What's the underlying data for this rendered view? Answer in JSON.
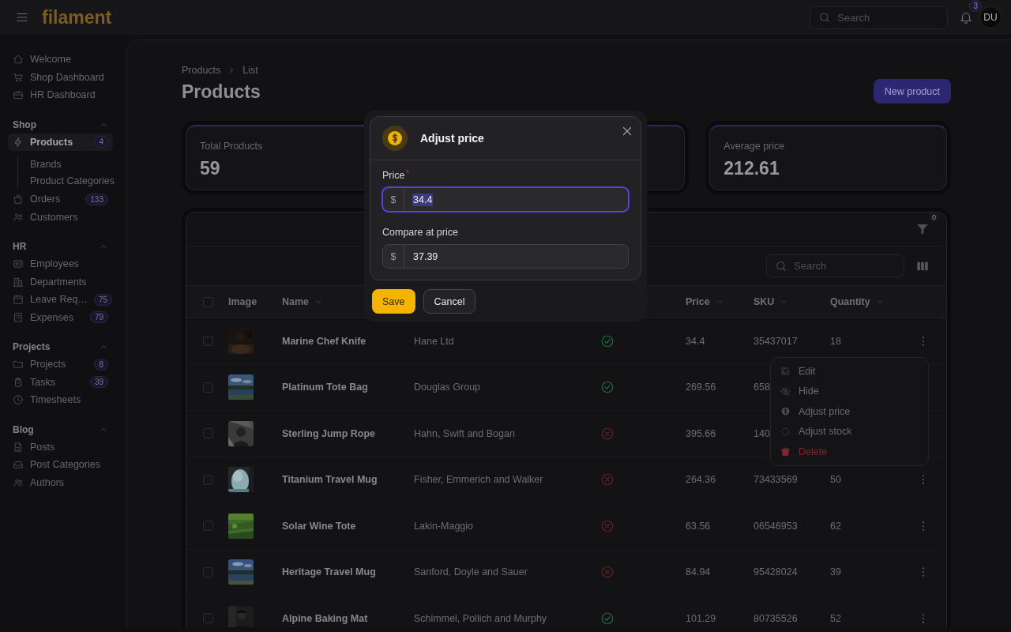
{
  "topbar": {
    "logo": "filament",
    "search": {
      "placeholder": "Search"
    },
    "notifications": {
      "count": "3"
    },
    "avatar": {
      "initials": "DU"
    }
  },
  "sidebar": {
    "groups": [
      {
        "items": [
          {
            "label": "Welcome",
            "selected": false
          },
          {
            "label": "Shop Dashboard",
            "selected": false
          },
          {
            "label": "HR Dashboard",
            "selected": false
          }
        ]
      },
      {
        "label": "Shop",
        "expanded": true,
        "items": [
          {
            "label": "Products",
            "badge": "4",
            "selected": true,
            "children": [
              {
                "label": "Brands",
                "selected": false
              },
              {
                "label": "Product Categories",
                "selected": false
              }
            ]
          },
          {
            "label": "Orders",
            "badge": "133",
            "selected": false
          },
          {
            "label": "Customers",
            "selected": false
          }
        ]
      },
      {
        "label": "HR",
        "expanded": true,
        "items": [
          {
            "label": "Employees",
            "selected": false
          },
          {
            "label": "Departments",
            "selected": false
          },
          {
            "label": "Leave Req…",
            "badge": "75",
            "selected": false
          },
          {
            "label": "Expenses",
            "badge": "79",
            "selected": false
          }
        ]
      },
      {
        "label": "Projects",
        "expanded": true,
        "items": [
          {
            "label": "Projects",
            "badge": "8",
            "selected": false
          },
          {
            "label": "Tasks",
            "badge": "39",
            "selected": false
          },
          {
            "label": "Timesheets",
            "selected": false
          }
        ]
      },
      {
        "label": "Blog",
        "expanded": true,
        "items": [
          {
            "label": "Posts",
            "selected": false
          },
          {
            "label": "Post Categories",
            "selected": false
          },
          {
            "label": "Authors",
            "selected": false
          }
        ]
      }
    ]
  },
  "breadcrumbs": [
    "Products",
    "List"
  ],
  "page_title": "Products",
  "header_action": {
    "label": "New product"
  },
  "stats": [
    {
      "kind": "stat",
      "label": "Total Products",
      "value": "59"
    },
    {
      "kind": "covered"
    },
    {
      "kind": "stat",
      "label": "Average price",
      "value": "212.61"
    }
  ],
  "table": {
    "filter_count": "0",
    "all_selected": false,
    "search": {
      "placeholder": "Search"
    },
    "columns": [
      {
        "kind": "label",
        "label": "Image",
        "sortable": false
      },
      {
        "kind": "label",
        "label": "Name",
        "sortable": true
      },
      {
        "kind": "covered"
      },
      {
        "kind": "covered"
      },
      {
        "kind": "label",
        "label": "Price",
        "sortable": true
      },
      {
        "kind": "label",
        "label": "SKU",
        "sortable": true
      },
      {
        "kind": "label",
        "label": "Quantity",
        "sortable": true
      }
    ],
    "rows": [
      {
        "selected": false,
        "name": "Marine Chef Knife",
        "brand": "Hane Ltd",
        "visible": true,
        "price": "34.4",
        "sku": "35437017",
        "quantity": "18",
        "actions": true
      },
      {
        "selected": false,
        "name": "Platinum Tote Bag",
        "brand": "Douglas Group",
        "visible": true,
        "price": "269.56",
        "sku": "658",
        "actions": false
      },
      {
        "selected": false,
        "name": "Sterling Jump Rope",
        "brand": "Hahn, Swift and Bogan",
        "visible": false,
        "price": "395.66",
        "sku": "140",
        "actions": false
      },
      {
        "selected": false,
        "name": "Titanium Travel Mug",
        "brand": "Fisher, Emmerich and Walker",
        "visible": false,
        "price": "264.36",
        "sku": "73433569",
        "quantity": "50",
        "actions": true
      },
      {
        "selected": false,
        "name": "Solar Wine Tote",
        "brand": "Lakin-Maggio",
        "visible": false,
        "price": "63.56",
        "sku": "06546953",
        "quantity": "62",
        "actions": true
      },
      {
        "selected": false,
        "name": "Heritage Travel Mug",
        "brand": "Sanford, Doyle and Sauer",
        "visible": false,
        "price": "84.94",
        "sku": "95428024",
        "quantity": "39",
        "actions": true
      },
      {
        "selected": false,
        "name": "Alpine Baking Mat",
        "brand": "Schimmel, Pollich and Murphy",
        "visible": true,
        "price": "101.29",
        "sku": "80735526",
        "quantity": "52",
        "actions": true
      }
    ]
  },
  "action_menu": {
    "items": [
      {
        "label": "Edit",
        "kind": "normal"
      },
      {
        "label": "Hide",
        "kind": "normal"
      },
      {
        "label": "Adjust price",
        "kind": "normal"
      },
      {
        "label": "Adjust stock",
        "kind": "normal"
      },
      {
        "label": "Delete",
        "kind": "danger"
      }
    ]
  },
  "modal": {
    "title": "Adjust price",
    "fields": [
      {
        "label": "Price",
        "required": true,
        "prefix": "$",
        "value": "34.4",
        "focused": true,
        "value_selected": true
      },
      {
        "label": "Compare at price",
        "required": false,
        "prefix": "$",
        "value": "37.39",
        "focused": false,
        "value_selected": false
      }
    ],
    "buttons": [
      {
        "label": "Save",
        "kind": "primary"
      },
      {
        "label": "Cancel",
        "kind": "secondary"
      }
    ]
  }
}
